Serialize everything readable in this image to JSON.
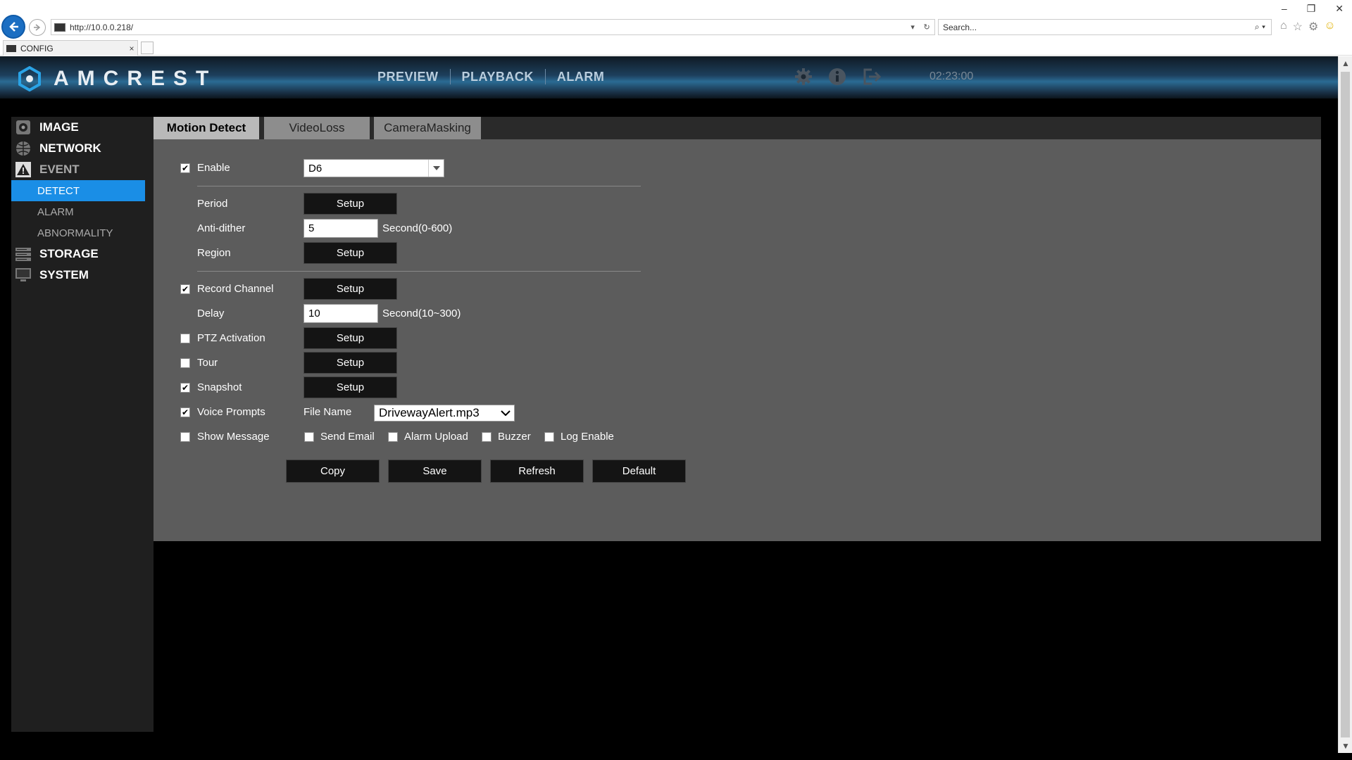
{
  "browser": {
    "url": "http://10.0.0.218/",
    "search_placeholder": "Search...",
    "tab_title": "CONFIG",
    "tab_close": "×",
    "window_controls": [
      "–",
      "❐",
      "✕"
    ]
  },
  "header": {
    "logo_text": "AMCREST",
    "nav": [
      "PREVIEW",
      "PLAYBACK",
      "ALARM"
    ],
    "clock": "02:23:00"
  },
  "sidebar": {
    "items": [
      {
        "label": "IMAGE",
        "icon": "camera-icon"
      },
      {
        "label": "NETWORK",
        "icon": "globe-icon"
      },
      {
        "label": "EVENT",
        "icon": "warning-icon"
      },
      {
        "label": "STORAGE",
        "icon": "storage-icon"
      },
      {
        "label": "SYSTEM",
        "icon": "monitor-icon"
      }
    ],
    "event_subitems": [
      "DETECT",
      "ALARM",
      "ABNORMALITY"
    ],
    "active_subitem": "DETECT"
  },
  "tabs": [
    "Motion Detect",
    "VideoLoss",
    "CameraMasking"
  ],
  "active_tab": "Motion Detect",
  "form": {
    "enable": {
      "label": "Enable",
      "checked": true
    },
    "channel": {
      "value": "D6"
    },
    "period": {
      "label": "Period",
      "button": "Setup"
    },
    "anti_dither": {
      "label": "Anti-dither",
      "value": "5",
      "unit": "Second(0-600)"
    },
    "region": {
      "label": "Region",
      "button": "Setup"
    },
    "record_channel": {
      "label": "Record Channel",
      "checked": true,
      "button": "Setup"
    },
    "delay": {
      "label": "Delay",
      "value": "10",
      "unit": "Second(10~300)"
    },
    "ptz_activation": {
      "label": "PTZ Activation",
      "checked": false,
      "button": "Setup"
    },
    "tour": {
      "label": "Tour",
      "checked": false,
      "button": "Setup"
    },
    "snapshot": {
      "label": "Snapshot",
      "checked": true,
      "button": "Setup"
    },
    "voice_prompts": {
      "label": "Voice Prompts",
      "checked": true,
      "file_label": "File Name",
      "file_value": "DrivewayAlert.mp3"
    },
    "show_message": {
      "label": "Show Message",
      "checked": false
    },
    "send_email": {
      "label": "Send Email",
      "checked": false
    },
    "alarm_upload": {
      "label": "Alarm Upload",
      "checked": false
    },
    "buzzer": {
      "label": "Buzzer",
      "checked": false
    },
    "log_enable": {
      "label": "Log Enable",
      "checked": false
    }
  },
  "actions": [
    "Copy",
    "Save",
    "Refresh",
    "Default"
  ],
  "colors": {
    "accent": "#1a8ee6",
    "panel": "#5c5c5c",
    "sidebar": "#1f1f1f",
    "button": "#141414"
  }
}
